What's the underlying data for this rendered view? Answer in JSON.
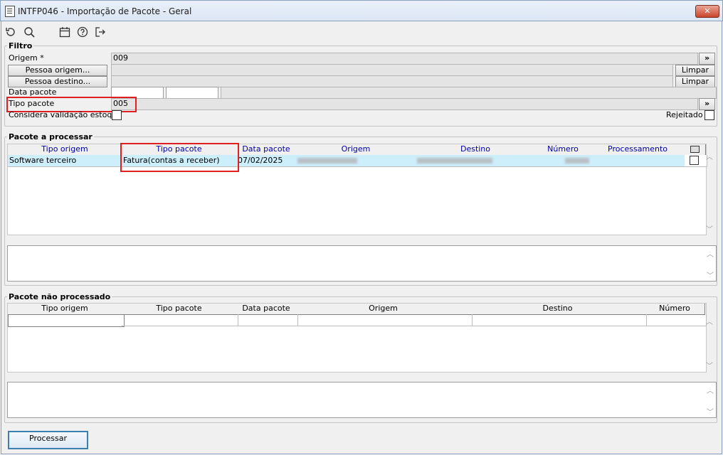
{
  "window": {
    "title": "INTFP046 - Importação de Pacote - Geral",
    "close": "✕"
  },
  "toolbar": {
    "icons": [
      "undo-icon",
      "search-icon",
      "calendar-icon",
      "help-icon",
      "exit-icon"
    ]
  },
  "filtro": {
    "title": "Filtro",
    "origem_label": "Origem *",
    "origem_value": "009",
    "pessoa_origem_btn": "Pessoa origem...",
    "pessoa_destino_btn": "Pessoa destino...",
    "limpar": "Limpar",
    "data_pacote_label": "Data pacote",
    "tipo_pacote_label": "Tipo pacote",
    "tipo_pacote_value": "005",
    "considera_label": "Considera validação estoque",
    "rejeitado_label": "Rejeitado",
    "lookup": "»"
  },
  "processar_grid": {
    "title": "Pacote a processar",
    "headers": [
      "Tipo origem",
      "Tipo pacote",
      "Data pacote",
      "Origem",
      "Destino",
      "Número",
      "Processamento"
    ],
    "rows": [
      {
        "tipo_origem": "Software terceiro",
        "tipo_pacote": "Fatura(contas a receber)",
        "data_pacote": "07/02/2025"
      }
    ]
  },
  "nao_processado_grid": {
    "title": "Pacote não processado",
    "headers": [
      "Tipo origem",
      "Tipo pacote",
      "Data pacote",
      "Origem",
      "Destino",
      "Número"
    ]
  },
  "actions": {
    "processar": "Processar"
  },
  "colors": {
    "selected_row": "#cdeefb",
    "highlight": "#e02020",
    "header_text": "#0000a0"
  }
}
